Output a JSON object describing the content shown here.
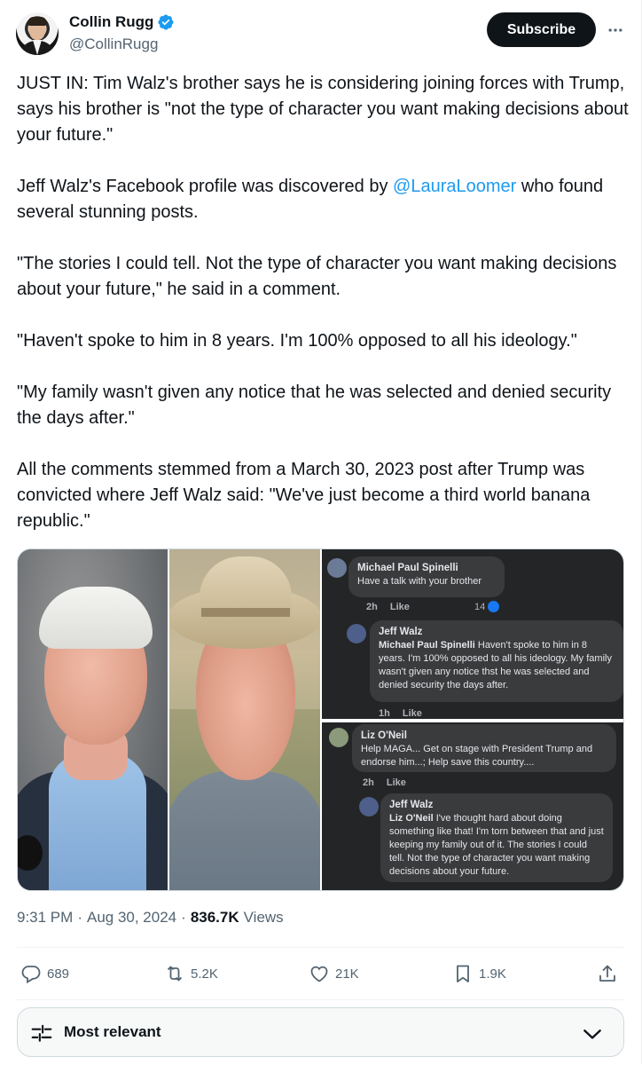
{
  "author": {
    "display_name": "Collin Rugg",
    "handle": "@CollinRugg",
    "subscribe_label": "Subscribe",
    "verified_color": "#1d9bf0"
  },
  "tweet": {
    "p1": "JUST IN: Tim Walz's brother says he is considering joining forces with Trump, says his brother is \"not the type of character you want making decisions about your future.\"",
    "p2_before": "Jeff Walz's Facebook profile was discovered by ",
    "p2_mention": "@LauraLoomer",
    "p2_after": " who found several stunning posts.",
    "p3": "\"The stories I could tell. Not the type of character you want making decisions about your future,\" he said in a comment.",
    "p4": "\"Haven't spoke to him in 8 years. I'm 100% opposed to all his ideology.\"",
    "p5": "\"My family wasn't given any notice that he was selected and denied security the days after.\"",
    "p6": "All the comments stemmed from a March 30, 2023 post after Trump was convicted where Jeff Walz said: \"We've just become a third world banana republic.\""
  },
  "media": {
    "comments_top": {
      "c1_name": "Michael Paul Spinelli",
      "c1_text": "Have a talk with your brother",
      "c1_time": "2h",
      "c1_like": "Like",
      "c1_likes": "14",
      "c2_name": "Jeff Walz",
      "c2_tag": "Michael Paul Spinelli",
      "c2_text": " Haven't spoke to him in 8 years. I'm 100% opposed to all his ideology. My family wasn't given any notice thst he was selected and denied security the days after.",
      "c2_time": "1h",
      "c2_like": "Like"
    },
    "comments_bottom": {
      "c1_name": "Liz O'Neil",
      "c1_text": "Help MAGA... Get on stage with President Trump and endorse him...; Help save this country....",
      "c1_time": "2h",
      "c1_like": "Like",
      "c2_name": "Jeff Walz",
      "c2_tag": "Liz O'Neil",
      "c2_text": " I've thought hard about doing something like that! I'm torn between that and just keeping my family out of it. The stories I could tell. Not the type of character you want making decisions about your future."
    }
  },
  "timestamp": {
    "time": "9:31 PM",
    "sep1": "·",
    "date": "Aug 30, 2024",
    "sep2": "·",
    "views_count": "836.7K",
    "views_label": "Views"
  },
  "actions": {
    "replies": "689",
    "reposts": "5.2K",
    "likes": "21K",
    "bookmarks": "1.9K"
  },
  "sort": {
    "label": "Most relevant"
  }
}
